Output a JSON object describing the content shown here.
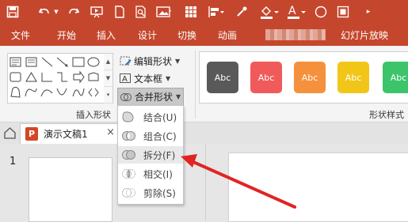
{
  "quick_access": {
    "icons": [
      "save-icon",
      "undo-icon",
      "undo-dropdown-icon",
      "redo-icon",
      "from-beginning-icon",
      "new-document-icon",
      "print-preview-icon",
      "picture-icon",
      "grid-icon",
      "align-icon",
      "eyedropper-icon",
      "fill-color-icon",
      "font-color-icon",
      "oval-icon",
      "align-objects-icon",
      "more-icon"
    ]
  },
  "ribbon_tabs": [
    "文件",
    "开始",
    "插入",
    "设计",
    "切换",
    "动画",
    "幻灯片放映"
  ],
  "ribbon": {
    "edit_shape": "编辑形状",
    "text_box": "文本框",
    "merge_shapes": "合并形状",
    "insert_shapes_group": "插入形状",
    "shape_styles_group": "形状样式",
    "style_swatches": [
      {
        "label": "Abc",
        "color": "#595959"
      },
      {
        "label": "Abc",
        "color": "#f05a5a"
      },
      {
        "label": "Abc",
        "color": "#f5913c"
      },
      {
        "label": "Abc",
        "color": "#f2c618"
      },
      {
        "label": "Abc",
        "color": "#3cc46a"
      }
    ]
  },
  "document_tab": {
    "name": "演示文稿1",
    "close": "×",
    "app_letter": "P"
  },
  "slide_panel": {
    "number": "1"
  },
  "merge_menu": {
    "items": [
      {
        "label": "结合(U)",
        "name": "menu-item-union"
      },
      {
        "label": "组合(C)",
        "name": "menu-item-combine"
      },
      {
        "label": "拆分(F)",
        "name": "menu-item-fragment"
      },
      {
        "label": "相交(I)",
        "name": "menu-item-intersect"
      },
      {
        "label": "剪除(S)",
        "name": "menu-item-subtract"
      }
    ]
  },
  "colors": {
    "accent": "#c4472d",
    "annotation_arrow": "#e02424"
  }
}
